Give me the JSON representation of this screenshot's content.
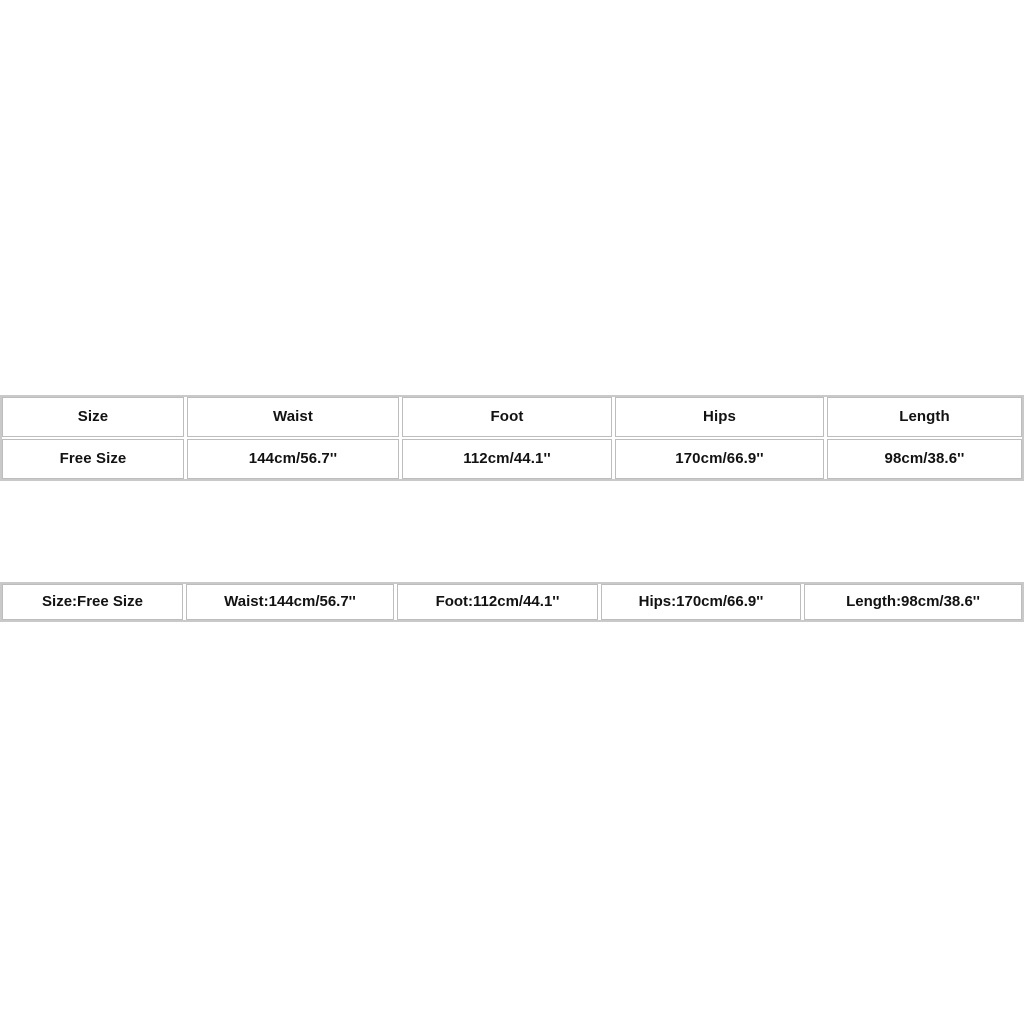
{
  "page": {
    "background_color": "#ffffff",
    "text_color": "#121212",
    "border_color": "#bdbdbd",
    "outer_border_color": "#c9c9c9"
  },
  "size_table": {
    "headers": [
      "Size",
      "Waist",
      "Foot",
      "Hips",
      "Length"
    ],
    "rows": [
      [
        "Free Size",
        "144cm/56.7''",
        "112cm/44.1''",
        "170cm/66.9''",
        "98cm/38.6''"
      ]
    ]
  },
  "summary_table": {
    "cells": [
      "Size:Free Size",
      "Waist:144cm/56.7''",
      "Foot:112cm/44.1''",
      "Hips:170cm/66.9''",
      "Length:98cm/38.6''"
    ]
  }
}
